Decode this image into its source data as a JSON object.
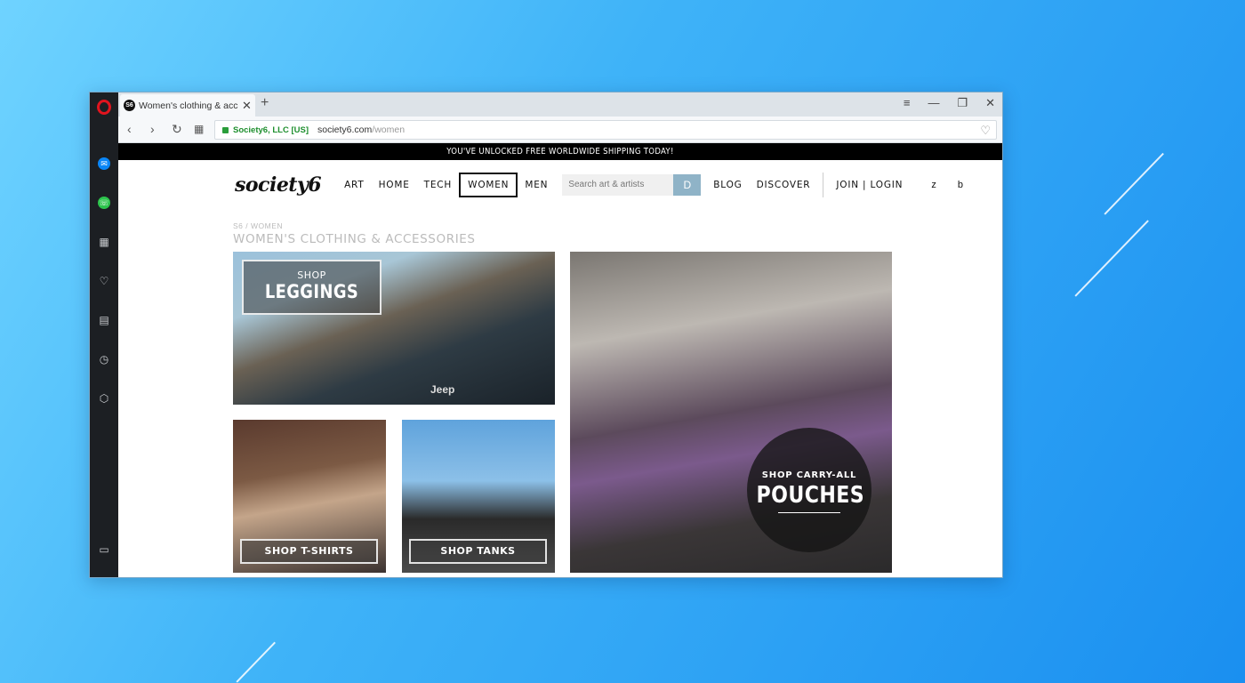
{
  "browser": {
    "tab_title": "Women's clothing & accessories",
    "tab_favicon": "S6",
    "new_tab_label": "+",
    "url_cert": "Society6, LLC [US]",
    "url_host": "society6.com",
    "url_path": "/women"
  },
  "site": {
    "banner": "YOU'VE UNLOCKED FREE WORLDWIDE SHIPPING TODAY!",
    "logo": "society6",
    "nav": [
      "ART",
      "HOME",
      "TECH",
      "WOMEN",
      "MEN"
    ],
    "search_placeholder": "Search art & artists",
    "search_button": "D",
    "nav_right": [
      "BLOG",
      "DISCOVER"
    ],
    "join_login": "JOIN | LOGIN",
    "icon_z": "z",
    "icon_b": "b",
    "breadcrumb": "S6  /  WOMEN",
    "page_title": "WOMEN'S CLOTHING & ACCESSORIES"
  },
  "tiles": {
    "leggings_small": "SHOP",
    "leggings_big": "LEGGINGS",
    "jeep": "Jeep",
    "tshirts": "SHOP T-SHIRTS",
    "tanks": "SHOP TANKS",
    "pouches_small": "SHOP CARRY-ALL",
    "pouches_big": "POUCHES"
  }
}
